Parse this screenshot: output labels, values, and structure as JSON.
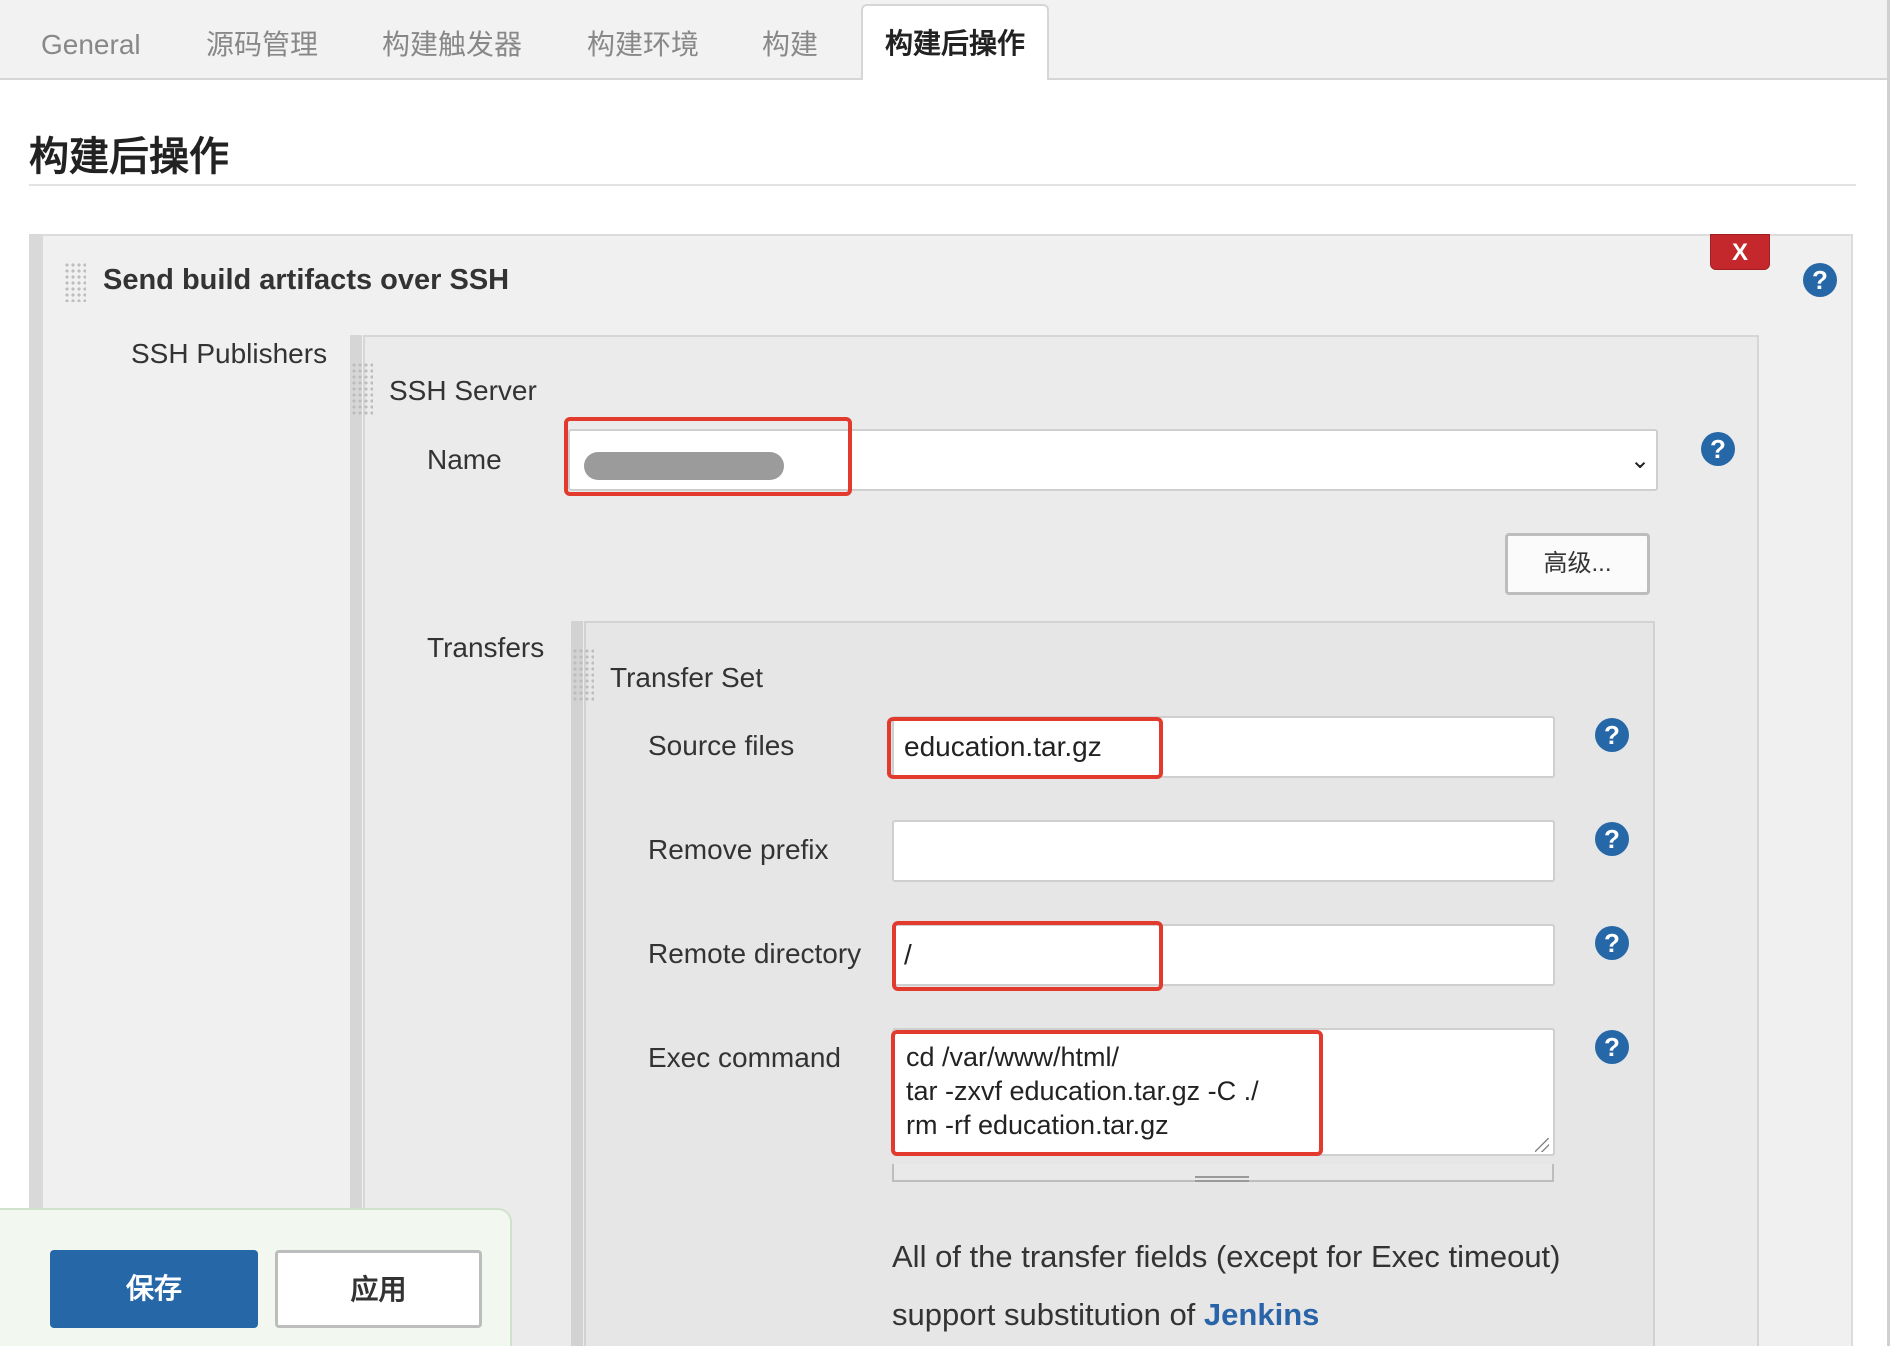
{
  "tabs": [
    {
      "label": "General"
    },
    {
      "label": "源码管理"
    },
    {
      "label": "构建触发器"
    },
    {
      "label": "构建环境"
    },
    {
      "label": "构建"
    },
    {
      "label": "构建后操作",
      "active": true
    }
  ],
  "section": {
    "title": "构建后操作"
  },
  "step": {
    "title": "Send build artifacts over SSH",
    "delete_label": "X",
    "help_icon": "?"
  },
  "ssh": {
    "publishers_label": "SSH Publishers",
    "server_label": "SSH Server",
    "name_label": "Name",
    "advanced_label": "高级...",
    "transfers_label": "Transfers",
    "transfer_set_label": "Transfer Set"
  },
  "transfer": {
    "source_label": "Source files",
    "source_value": "education.tar.gz",
    "prefix_label": "Remove prefix",
    "prefix_value": "",
    "remote_label": "Remote directory",
    "remote_value": "/",
    "exec_label": "Exec command",
    "exec_value": "cd /var/www/html/\ntar -zxvf education.tar.gz -C ./\nrm -rf education.tar.gz"
  },
  "note": {
    "text": "All of the transfer fields (except for Exec timeout) support substitution of ",
    "link": "Jenkins"
  },
  "buttons": {
    "save": "保存",
    "apply": "应用"
  },
  "colors": {
    "accent": "#2667a8",
    "danger": "#c4282c",
    "highlight": "#e23b2e"
  }
}
